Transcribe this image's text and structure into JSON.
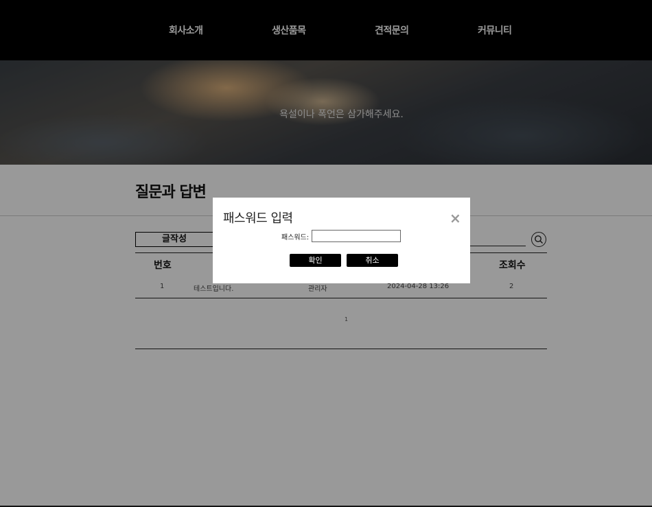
{
  "nav": {
    "items": [
      "회사소개",
      "생산품목",
      "견적문의",
      "커뮤니티"
    ]
  },
  "hero": {
    "text": "욕설이나 폭언은 삼가해주세요."
  },
  "board": {
    "title": "질문과 답변",
    "write_label": "글작성",
    "search_placeholder": "",
    "columns": {
      "number": "번호",
      "views": "조회수"
    },
    "rows": [
      {
        "number": "1",
        "title": "테스트입니다.",
        "author": "관리자",
        "date": "2024-04-28 13:26",
        "views": "2"
      }
    ],
    "pagination": [
      "1"
    ]
  },
  "modal": {
    "title": "패스워드 입력",
    "close": "×",
    "password_label": "패스워드:",
    "password_value": "",
    "confirm_label": "확인",
    "cancel_label": "취소"
  },
  "colors": {
    "nav_bg": "#000000",
    "overlay": "rgba(0,0,0,0.4)",
    "button_bg": "#000000"
  }
}
